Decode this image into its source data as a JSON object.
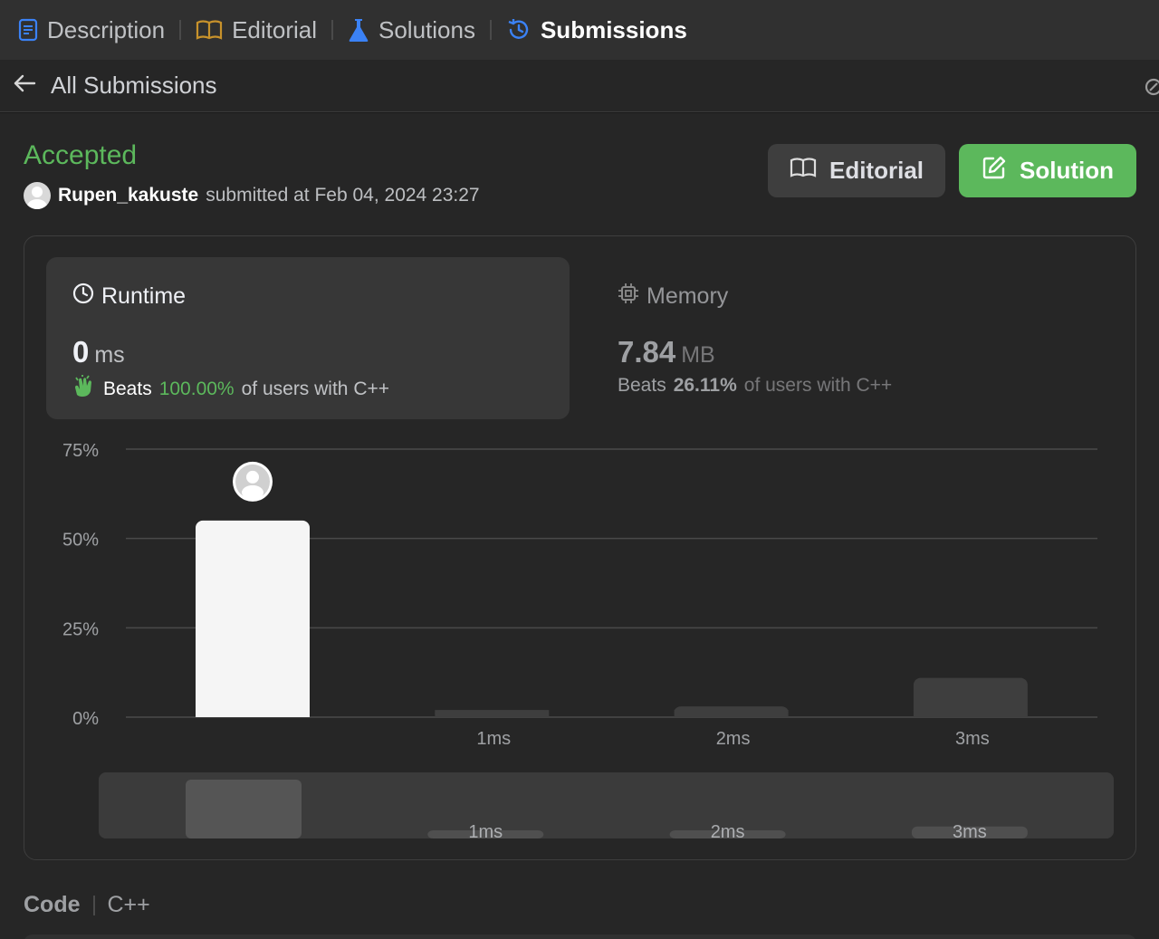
{
  "tabs": [
    {
      "label": "Description",
      "icon": "description-icon"
    },
    {
      "label": "Editorial",
      "icon": "book-icon"
    },
    {
      "label": "Solutions",
      "icon": "flask-icon"
    },
    {
      "label": "Submissions",
      "icon": "history-icon"
    }
  ],
  "active_tab": "Submissions",
  "subheader": {
    "back_label": "All Submissions"
  },
  "submission": {
    "status": "Accepted",
    "username": "Rupen_kakuste",
    "submitted_text": "submitted at Feb 04, 2024 23:27"
  },
  "buttons": {
    "editorial": "Editorial",
    "solution": "Solution"
  },
  "runtime": {
    "title": "Runtime",
    "value": "0",
    "unit": "ms",
    "beats_label": "Beats",
    "beats_pct": "100.00%",
    "beats_suffix": "of users with C++"
  },
  "memory": {
    "title": "Memory",
    "value": "7.84",
    "unit": "MB",
    "beats_label": "Beats",
    "beats_pct": "26.11%",
    "beats_suffix": "of users with C++"
  },
  "code": {
    "label": "Code",
    "language": "C++"
  },
  "colors": {
    "accent_green": "#5cb85c",
    "active_tab_icon": "#3b82f6"
  },
  "chart_data": {
    "type": "bar",
    "categories": [
      "",
      "1ms",
      "2ms",
      "3ms"
    ],
    "values": [
      55,
      2,
      3,
      11
    ],
    "ylim": [
      0,
      75
    ],
    "y_ticks": [
      "0%",
      "25%",
      "50%",
      "75%"
    ],
    "y_tick_values": [
      0,
      25,
      50,
      75
    ],
    "highlighted_index": 0,
    "grid": true,
    "overview": {
      "categories": [
        "",
        "1ms",
        "2ms",
        "3ms"
      ],
      "values": [
        55,
        2,
        3,
        11
      ]
    }
  }
}
